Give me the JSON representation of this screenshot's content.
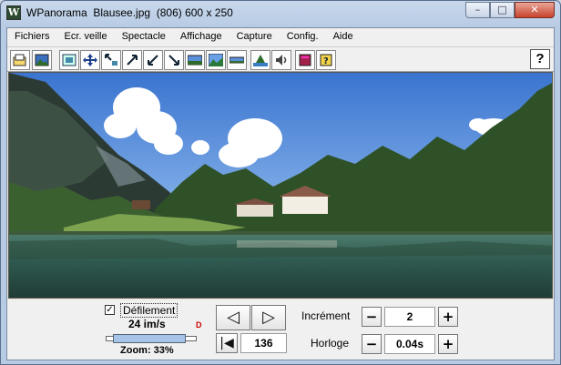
{
  "window": {
    "app_icon": "W",
    "title": "WPanorama  Blausee.jpg  (806) 600 x 250",
    "minimize": "–",
    "maximize": "□",
    "close": "✕"
  },
  "menu": [
    "Fichiers",
    "Ecr. veille",
    "Spectacle",
    "Affichage",
    "Capture",
    "Config.",
    "Aide"
  ],
  "toolbar": {
    "buttons": [
      {
        "name": "open-file-icon"
      },
      {
        "name": "image-icon"
      },
      {
        "name": "fit-window-icon"
      },
      {
        "name": "move-icon"
      },
      {
        "name": "zoom-in-icon"
      },
      {
        "name": "arrow-ne-icon"
      },
      {
        "name": "arrow-sw-icon"
      },
      {
        "name": "arrow-se-icon"
      },
      {
        "name": "panorama-icon"
      },
      {
        "name": "landscape-icon"
      },
      {
        "name": "strip-icon"
      },
      {
        "name": "mountain-icon"
      },
      {
        "name": "sound-icon"
      },
      {
        "name": "book-icon"
      },
      {
        "name": "help-book-icon"
      }
    ],
    "help": "?"
  },
  "controls": {
    "scroll_checked": "✓",
    "scroll_label": "Défilement",
    "speed": "24 im/s",
    "speed_icon": "D",
    "zoom_fraction": 0.33,
    "zoom_label": "Zoom: 33%",
    "prev_symbol": "◁",
    "next_symbol": "▷",
    "first_symbol": "|◀",
    "frame_value": "136",
    "increment_label": "Incrément",
    "increment_value": "2",
    "clock_label": "Horloge",
    "clock_value": "0.04s",
    "minus": "−",
    "plus": "+"
  },
  "colors": {
    "sky": "#4a86d8",
    "water": "#2e5a52",
    "forest": "#2f5128",
    "title_bar": "#b7cbe4"
  }
}
